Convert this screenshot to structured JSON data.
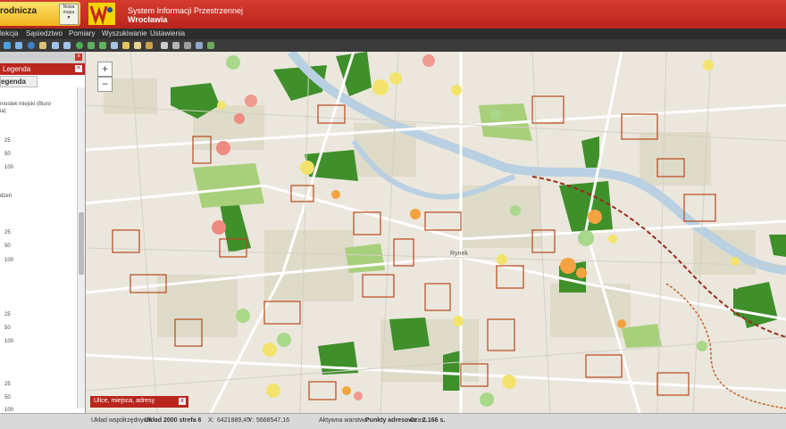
{
  "header": {
    "selector_label": "rodnicza",
    "nav_label_1": "Nowa",
    "nav_label_2": "mapa",
    "system_title": "System Informacji Przestrzennej",
    "system_subtitle": "Wrocławia"
  },
  "menu": [
    "lekcja",
    "Sąsiedztwo",
    "Pomiary",
    "Wyszukiwanie",
    "Ustawienia"
  ],
  "panel": {
    "header": "Legenda",
    "tab": "egenda",
    "legend_lines": [
      "mostek miejski (Biuro",
      "ia)",
      "25",
      "50",
      "100",
      "dzeń",
      "25",
      "50",
      "100",
      "25",
      "50",
      "100",
      "25",
      "50",
      "100"
    ]
  },
  "zoom": {
    "in": "+",
    "out": "−"
  },
  "search": {
    "label": "Ulice, miejsca, adresy",
    "close": "x"
  },
  "status": {
    "coord_label": "Układ współrzędnych:",
    "coord_value": "Układ 2000 strefa 6",
    "x_label": "X:",
    "x_value": "6421889,45",
    "y_label": "Y:",
    "y_value": "5668547,16",
    "layer_label": "Aktywna warstwa:",
    "layer_value": "Punkty adresowe",
    "time_label": "Czas:",
    "time_value": "2.166 s."
  },
  "map_labels": [
    "Rynek"
  ],
  "colors": {
    "header_red": "#c0281d",
    "accent_yellow": "#f6c62b",
    "park_green": "#3f8f2a",
    "parcel_red": "#b8481c"
  }
}
